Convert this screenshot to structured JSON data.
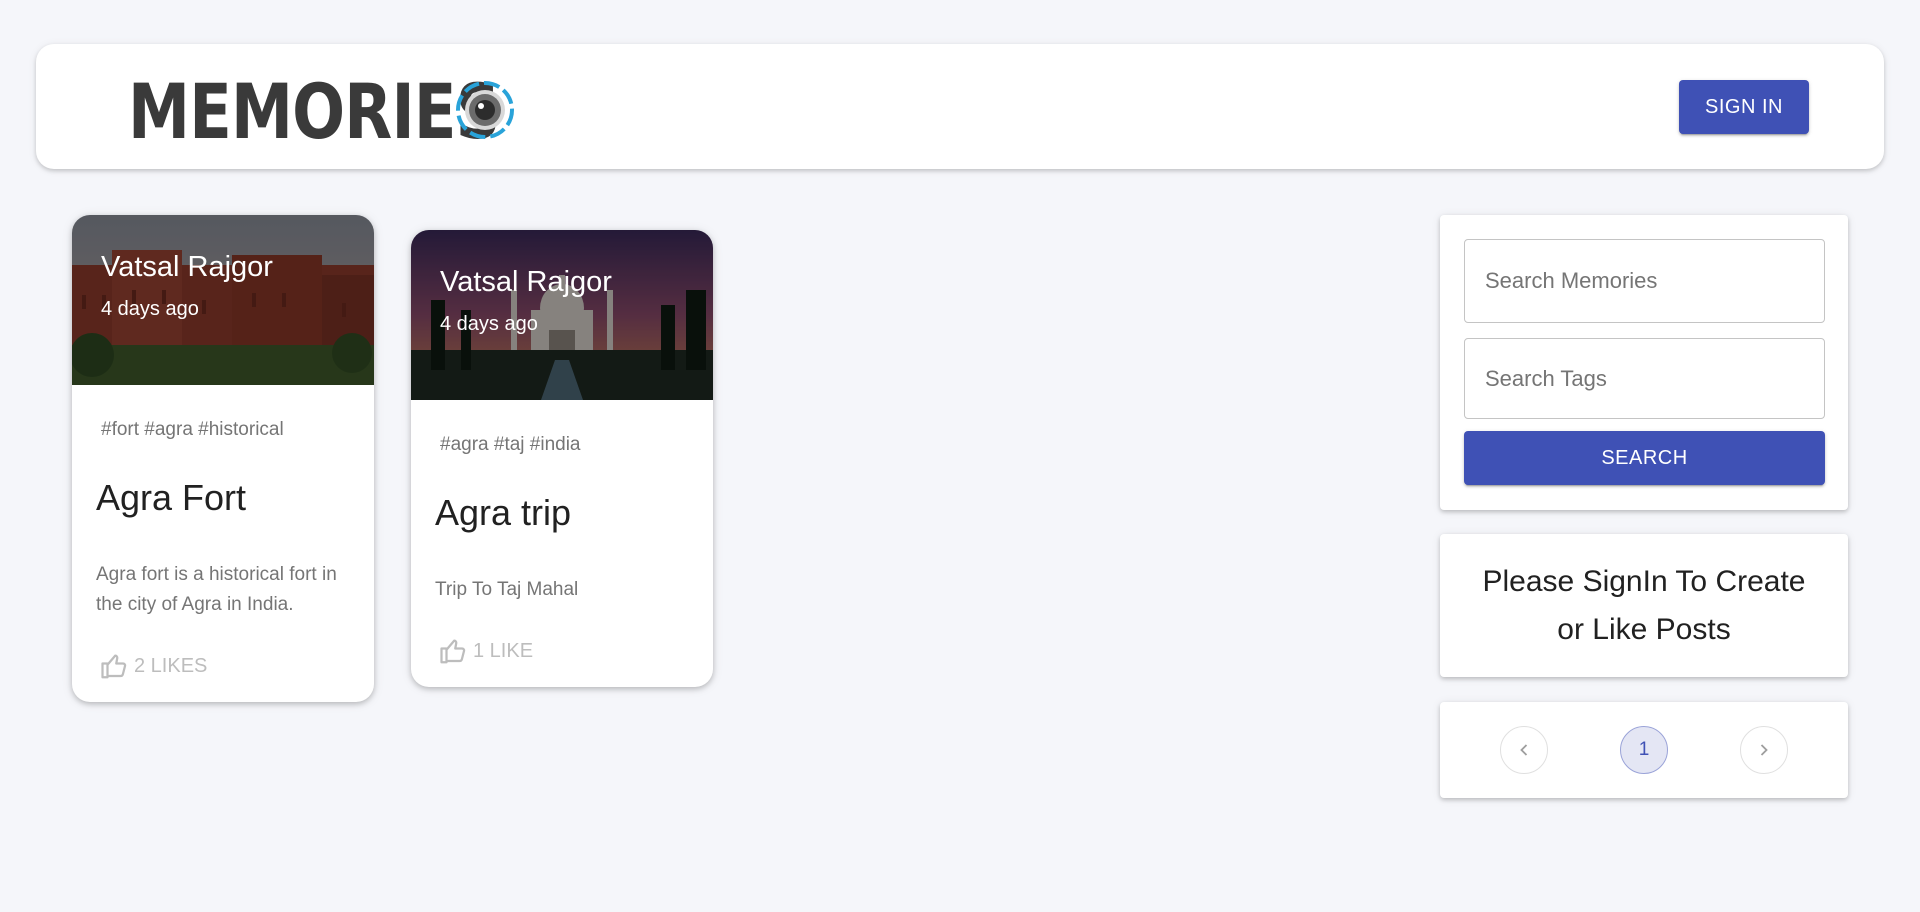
{
  "header": {
    "brand_text": "MEMORIES",
    "signin_label": "SIGN IN",
    "brand_color": "#3a3a3a",
    "accent_color": "#3f51b5"
  },
  "posts": [
    {
      "author": "Vatsal Rajgor",
      "time": "4 days ago",
      "tags": "#fort #agra #historical",
      "title": "Agra Fort",
      "message": "Agra fort is a historical fort in the city of Agra in India.",
      "likes": "2 LIKES"
    },
    {
      "author": "Vatsal Rajgor",
      "time": "4 days ago",
      "tags": "#agra #taj #india",
      "title": "Agra trip",
      "message": "Trip To Taj Mahal",
      "likes": "1 LIKE"
    }
  ],
  "search": {
    "memories_placeholder": "Search Memories",
    "tags_placeholder": "Search Tags",
    "button_label": "SEARCH"
  },
  "signin_prompt": {
    "text": "Please SignIn To Create or Like Posts"
  },
  "pagination": {
    "current_page": "1",
    "prev_icon": "chevron-left-icon",
    "next_icon": "chevron-right-icon"
  }
}
